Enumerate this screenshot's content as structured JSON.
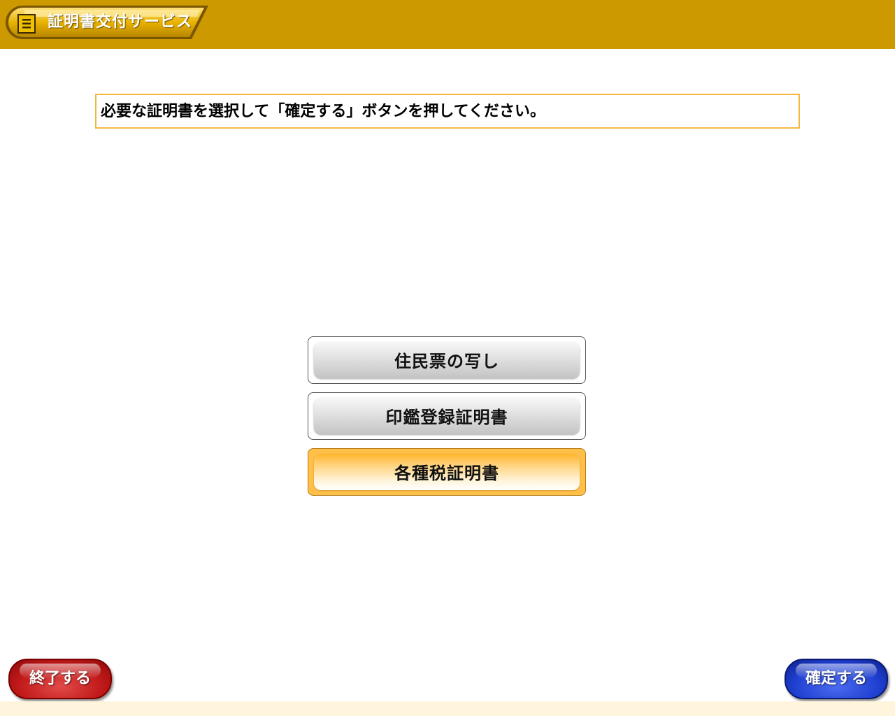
{
  "header": {
    "service_title": "証明書交付サービス",
    "icon": "book-icon",
    "color": "#cc9900"
  },
  "instruction": {
    "text": "必要な証明書を選択して「確定する」ボタンを押してください。"
  },
  "options": [
    {
      "label": "住民票の写し",
      "selected": false
    },
    {
      "label": "印鑑登録証明書",
      "selected": false
    },
    {
      "label": "各種税証明書",
      "selected": true
    }
  ],
  "buttons": {
    "exit_label": "終了する",
    "exit_color": "#c01818",
    "confirm_label": "確定する",
    "confirm_color": "#1f3fd0"
  }
}
